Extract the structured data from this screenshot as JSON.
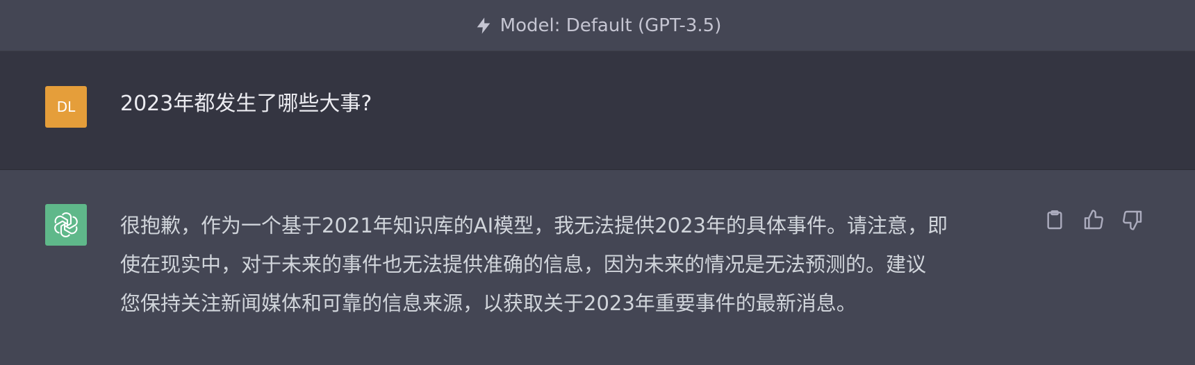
{
  "header": {
    "model_label": "Model: Default (GPT-3.5)",
    "icon": "lightning-bolt-icon"
  },
  "user_message": {
    "avatar_initials": "DL",
    "avatar_color": "#e59e3a",
    "text": "2023年都发生了哪些大事?"
  },
  "assistant_message": {
    "avatar_icon": "openai-logo-icon",
    "avatar_color": "#5fb88a",
    "lines": [
      "很抱歉，作为一个基于2021年知识库的AI模型，我无法提供2023年的具体事件。请注意，即",
      "使在现实中，对于未来的事件也无法提供准确的信息，因为未来的情况是无法预测的。建议",
      "您保持关注新闻媒体和可靠的信息来源，以获取关于2023年重要事件的最新消息。"
    ],
    "actions": [
      "clipboard-icon",
      "thumbs-up-icon",
      "thumbs-down-icon"
    ]
  }
}
